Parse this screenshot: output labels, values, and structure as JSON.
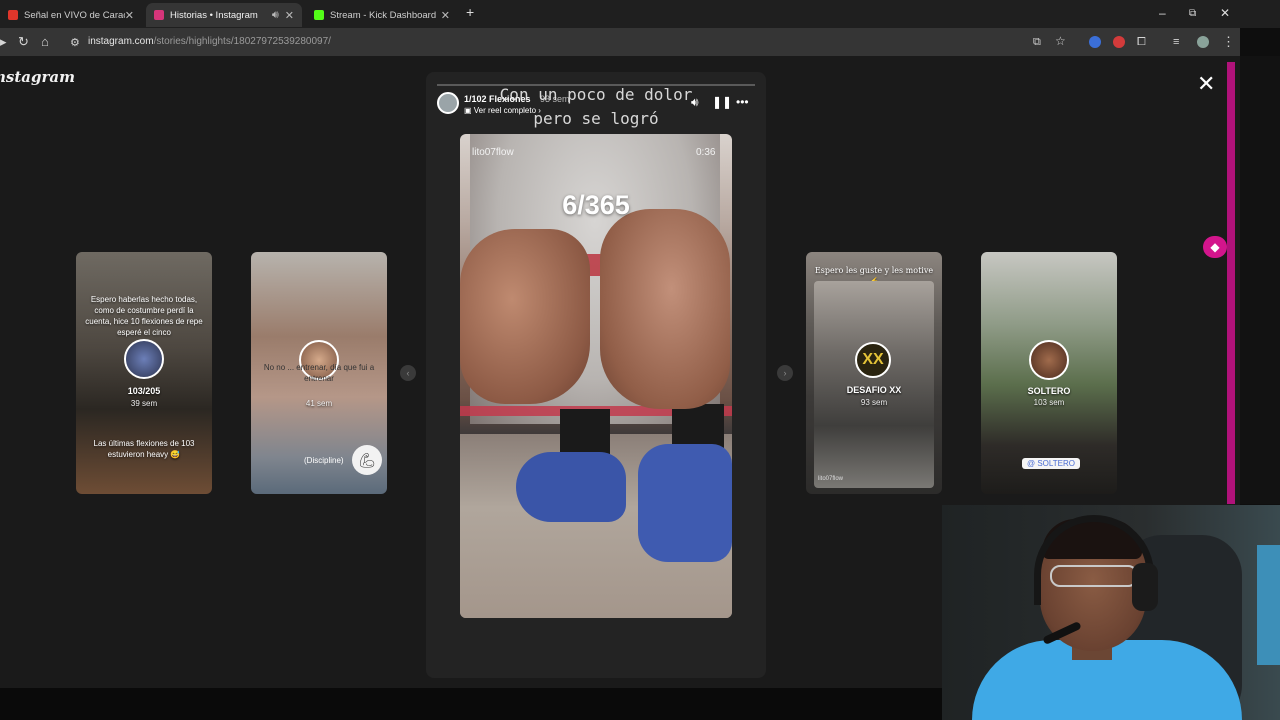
{
  "browser": {
    "tabs": [
      {
        "title": "Señal en VIVO de Caracol Telev",
        "favicon_color": "#e0362b",
        "active": false
      },
      {
        "title": "Historias • Instagram",
        "favicon_color": "#d6357a",
        "active": true
      },
      {
        "title": "Stream - Kick Dashboard",
        "favicon_color": "#53fc18",
        "active": false
      }
    ],
    "new_tab_icon": "plus-icon",
    "window_controls": [
      "minimize-icon",
      "restore-icon",
      "close-icon"
    ],
    "url_domain": "instagram.com",
    "url_path": "/stories/highlights/18027972539280097/"
  },
  "instagram": {
    "logo_text": "Instagram",
    "close_icon": "close-icon",
    "main_story": {
      "title": "1/102 Flexiones",
      "time": "93 sem",
      "reel_link": "Ver reel completo",
      "caption_overlay": "Con un poco de dolor pero se logró",
      "video_user": "lito07flow",
      "video_duration": "0:36",
      "video_counter": "6/365"
    },
    "side_stories": {
      "left1": {
        "top_text": "Espero haberlas hecho todas, como de costumbre perdí la cuenta, hice 10 flexiones de repe esperé el cinco",
        "name": "103/205",
        "age": "39 sem",
        "bottom_text": "Las últimas flexiones de 103 estuvieron heavy 😅"
      },
      "left2": {
        "text": "No no ... entrenar, día que fui a entrenar",
        "age": "41 sem",
        "tag": "(Discipline)"
      },
      "right1": {
        "top_text": "Espero les guste y les motive ⚡",
        "badge": "XX",
        "name": "DESAFIO XX",
        "age": "93 sem",
        "footer": "lito07flow"
      },
      "right2": {
        "name": "SOLTERO",
        "age": "103 sem",
        "tag": "@ SOLTERO"
      }
    }
  },
  "colors": {
    "accent_magenta": "#d3158c"
  }
}
